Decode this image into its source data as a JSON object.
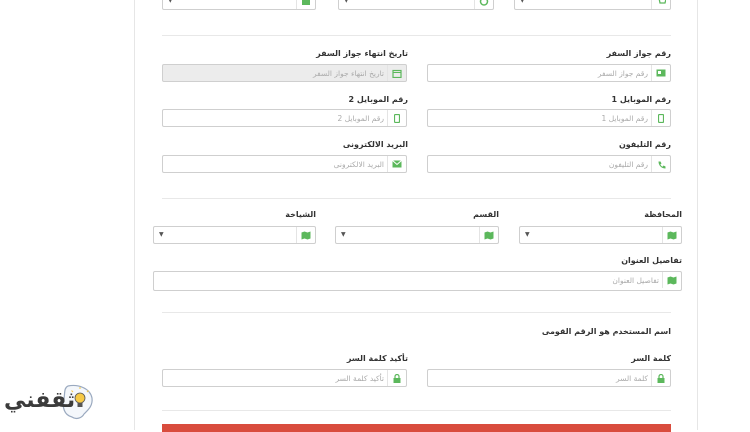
{
  "colors": {
    "accent_green": "#5cb85c",
    "submit_red": "#d94c3d"
  },
  "passport": {
    "number_label": "رقم جواز السفر",
    "number_placeholder": "رقم جواز السفر",
    "expiry_label": "تاريخ انتهاء جواز السفر",
    "expiry_placeholder": "تاريخ انتهاء جواز السفر"
  },
  "mobile1": {
    "label": "رقم الموبايل 1",
    "placeholder": "رقم الموبايل 1"
  },
  "mobile2": {
    "label": "رقم الموبايل 2",
    "placeholder": "رقم الموبايل 2"
  },
  "phone": {
    "label": "رقم التليفون",
    "placeholder": "رقم التليفون"
  },
  "email": {
    "label": "البريد الالكترونى",
    "placeholder": "البريد الالكترونى"
  },
  "governorate": {
    "label": "المحافظة"
  },
  "district": {
    "label": "القسم"
  },
  "village": {
    "label": "الشياخة"
  },
  "address": {
    "label": "تفاصيل العنوان",
    "placeholder": "تفاصيل العنوان"
  },
  "account": {
    "note": "اسم المستخدم هو الرقم القومى"
  },
  "password": {
    "label": "كلمة السر",
    "placeholder": "كلمة السر"
  },
  "confirm": {
    "label": "تأكيد كلمة السر",
    "placeholder": "تأكيد كلمة السر"
  },
  "logo": {
    "text": "ثقفني"
  }
}
